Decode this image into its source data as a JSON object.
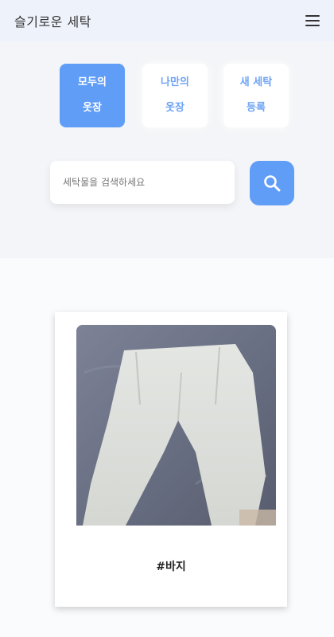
{
  "header": {
    "title": "슬기로운 세탁",
    "menu_icon": "hamburger-menu-icon"
  },
  "tabs": [
    {
      "line1": "모두의",
      "line2": "옷장",
      "active": true
    },
    {
      "line1": "나만의",
      "line2": "옷장",
      "active": false
    },
    {
      "line1": "새 세탁",
      "line2": "등록",
      "active": false
    }
  ],
  "search": {
    "placeholder": "세탁물을 검색하세요",
    "value": "",
    "button_icon": "search-icon"
  },
  "items": [
    {
      "tag": "#바지",
      "image": "white-pants-photo"
    }
  ],
  "colors": {
    "accent": "#5f9df7",
    "accent_text": "#6da3f4",
    "header_bg": "#eef2fb"
  }
}
